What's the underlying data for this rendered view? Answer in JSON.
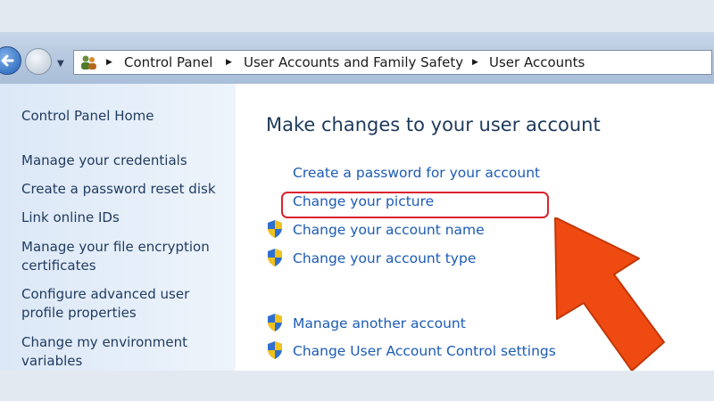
{
  "breadcrumb": {
    "items": [
      "Control Panel",
      "User Accounts and Family Safety",
      "User Accounts"
    ]
  },
  "sidebar": {
    "home": "Control Panel Home",
    "items": [
      {
        "label": "Manage your credentials"
      },
      {
        "label": "Create a password reset disk"
      },
      {
        "label": "Link online IDs"
      },
      {
        "label": "Manage your file encryption certificates"
      },
      {
        "label": "Configure advanced user profile properties"
      },
      {
        "label": "Change my environment variables"
      }
    ]
  },
  "main": {
    "title": "Make changes to your user account",
    "links": [
      {
        "label": "Create a password for your account",
        "icon": "none"
      },
      {
        "label": "Change your picture",
        "icon": "none"
      },
      {
        "label": "Change your account name",
        "icon": "uac-shield-icon"
      },
      {
        "label": "Change your account type",
        "icon": "uac-shield-icon"
      }
    ],
    "more_links": [
      {
        "label": "Manage another account",
        "icon": "uac-shield-icon"
      },
      {
        "label": "Change User Account Control settings",
        "icon": "uac-shield-icon"
      }
    ]
  },
  "annotation": {
    "highlight_color": "#d9232d",
    "arrow_color": "#ee4a12"
  },
  "colors": {
    "link": "#1c5bb5",
    "title": "#1e395b",
    "sidebar_text": "#1f3a5f"
  }
}
